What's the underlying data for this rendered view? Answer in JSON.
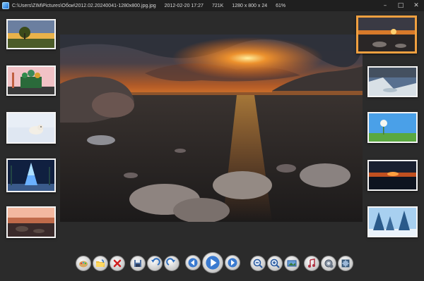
{
  "titlebar": {
    "path": "C:\\Users\\ZIM\\Pictures\\Обои\\2012.02.20240041-1280x800.jpg.jpg",
    "date": "2012-02-20 17:27",
    "size": "721K",
    "dimensions": "1280 x 800 x 24",
    "zoom": "61%"
  },
  "window": {
    "minimize": "–",
    "maximize": "□",
    "close": "✕"
  },
  "accent_color": "#f0a040",
  "thumbnails_left": [
    {
      "subject": "tree at sunset"
    },
    {
      "subject": "cathedral with domes"
    },
    {
      "subject": "snowy animal"
    },
    {
      "subject": "lit christmas tree"
    },
    {
      "subject": "shore sunset"
    }
  ],
  "thumbnails_right": [
    {
      "subject": "beach sunset (selected)"
    },
    {
      "subject": "seaside rocks"
    },
    {
      "subject": "dandelion on meadow"
    },
    {
      "subject": "sunset over sea"
    },
    {
      "subject": "snowy trees"
    }
  ],
  "toolbar": [
    {
      "icon": "paint-icon"
    },
    {
      "icon": "open-folder-icon"
    },
    {
      "icon": "delete-icon"
    },
    {
      "icon": "save-icon"
    },
    {
      "icon": "rotate-left-icon"
    },
    {
      "icon": "rotate-right-icon"
    },
    {
      "icon": "previous-icon"
    },
    {
      "icon": "play-icon"
    },
    {
      "icon": "next-icon"
    },
    {
      "icon": "zoom-out-icon"
    },
    {
      "icon": "zoom-in-icon"
    },
    {
      "icon": "fit-image-icon"
    },
    {
      "icon": "music-icon"
    },
    {
      "icon": "settings-icon"
    },
    {
      "icon": "fullscreen-icon"
    }
  ]
}
